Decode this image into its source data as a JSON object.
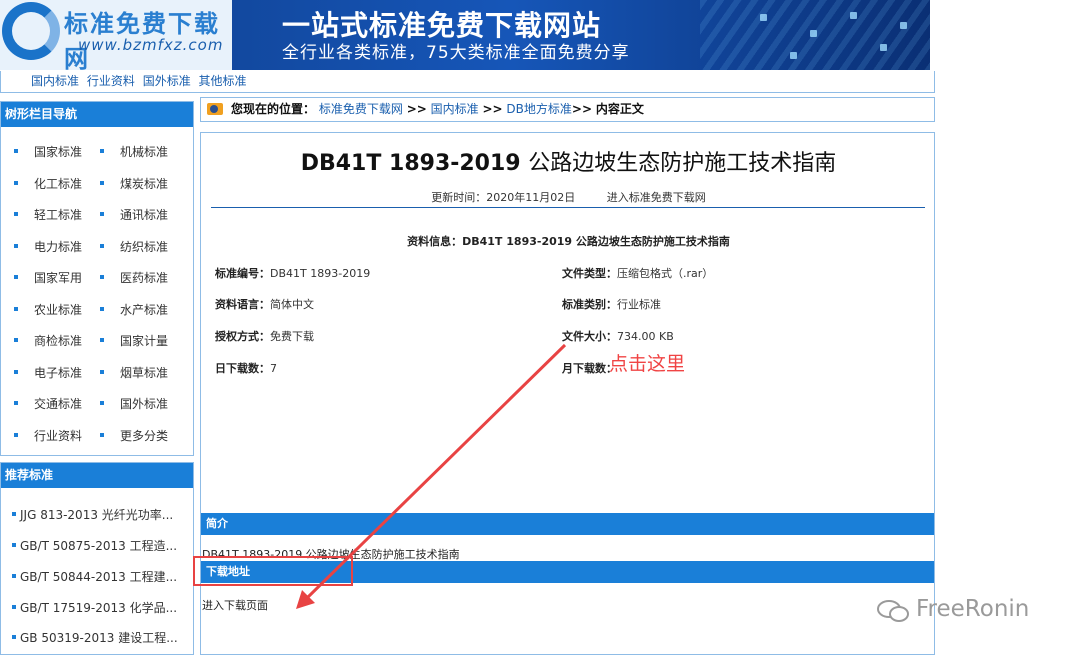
{
  "banner": {
    "logo_title": "标准免费下载网",
    "logo_url": "www.bzmfxz.com",
    "main": "一站式标准免费下载网站",
    "sub": "全行业各类标准，75大类标准全面免费分享"
  },
  "topnav": [
    "国内标准",
    "行业资料",
    "国外标准",
    "其他标准"
  ],
  "sidebar": {
    "nav_title": "树形栏目导航",
    "categories": [
      [
        "国家标准",
        "机械标准"
      ],
      [
        "化工标准",
        "煤炭标准"
      ],
      [
        "轻工标准",
        "通讯标准"
      ],
      [
        "电力标准",
        "纺织标准"
      ],
      [
        "国家军用",
        "医药标准"
      ],
      [
        "农业标准",
        "水产标准"
      ],
      [
        "商检标准",
        "国家计量"
      ],
      [
        "电子标准",
        "烟草标准"
      ],
      [
        "交通标准",
        "国外标准"
      ],
      [
        "行业资料",
        "更多分类"
      ]
    ],
    "rec_title": "推荐标准",
    "recommended": [
      "JJG 813-2013 光纤光功率...",
      "GB/T 50875-2013 工程造...",
      "GB/T 50844-2013 工程建...",
      "GB/T 17519-2013 化学品...",
      "GB 50319-2013 建设工程..."
    ]
  },
  "location": {
    "label": "您现在的位置：",
    "crumb1": "标准免费下载网",
    "sep": ">>",
    "crumb2": "国内标准",
    "crumb3": "DB地方标准",
    "current": "内容正文"
  },
  "doc": {
    "title_code": "DB41T 1893-2019",
    "title_name": "公路边坡生态防护施工技术指南",
    "update_time": "更新时间：2020年11月02日",
    "enter_site": "进入标准免费下载网",
    "info_head": "资料信息：DB41T 1893-2019 公路边坡生态防护施工技术指南",
    "fields": {
      "code_label": "标准编号：",
      "code": "DB41T 1893-2019",
      "filetype_label": "文件类型：",
      "filetype": "压缩包格式（.rar）",
      "lang_label": "资料语言：",
      "lang": "简体中文",
      "category_label": "标准类别：",
      "category": "行业标准",
      "license_label": "授权方式：",
      "license": "免费下载",
      "size_label": "文件大小：",
      "size": "734.00 KB",
      "daily_label": "日下载数：",
      "daily": "7",
      "monthly_label": "月下载数："
    },
    "intro_title": "简介",
    "intro_text": "DB41T 1893-2019 公路边坡生态防护施工技术指南",
    "download_title": "下载地址",
    "download_link": "进入下载页面"
  },
  "annotation": {
    "text": "点击这里",
    "color": "#f04444"
  },
  "watermark": "FreeRonin"
}
